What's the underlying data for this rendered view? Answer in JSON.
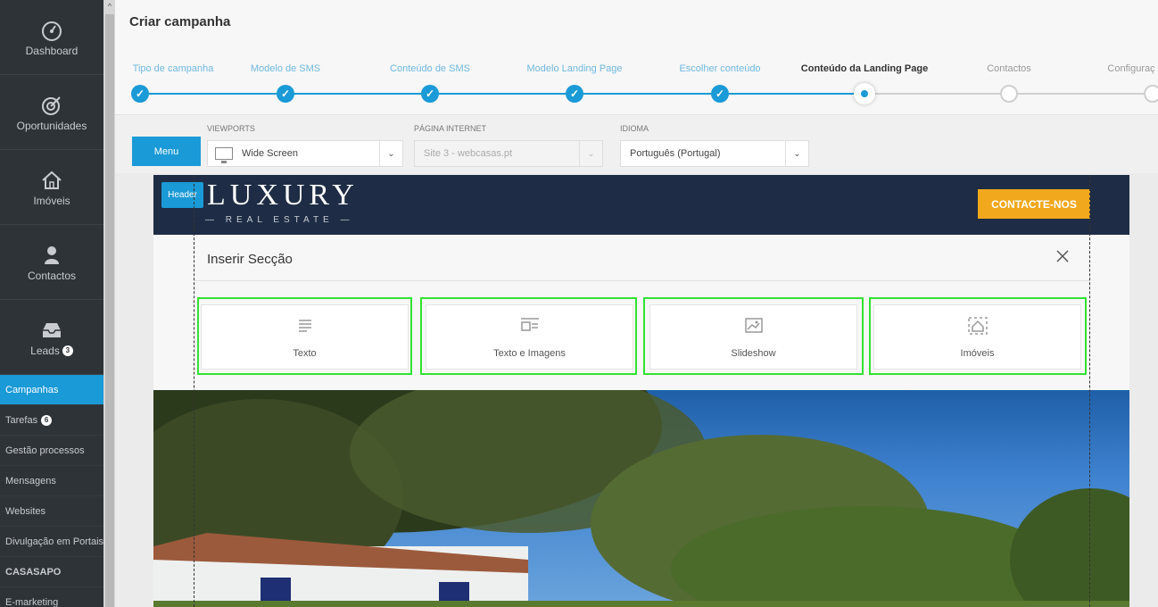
{
  "sidebar": {
    "big_items": [
      {
        "label": "Dashboard",
        "icon": "speedometer-icon"
      },
      {
        "label": "Oportunidades",
        "icon": "target-icon"
      },
      {
        "label": "Imóveis",
        "icon": "house-icon"
      },
      {
        "label": "Contactos",
        "icon": "person-icon"
      },
      {
        "label": "Leads",
        "icon": "inbox-icon",
        "badge": "3"
      }
    ],
    "small_items": [
      {
        "label": "Campanhas",
        "active": true
      },
      {
        "label": "Tarefas",
        "badge": "6"
      },
      {
        "label": "Gestão processos"
      },
      {
        "label": "Mensagens"
      },
      {
        "label": "Websites"
      },
      {
        "label": "Divulgação em Portais"
      },
      {
        "label": "CASASAPO"
      },
      {
        "label": "E-marketing"
      }
    ]
  },
  "header": {
    "title": "Criar campanha",
    "steps": [
      {
        "label": "Tipo de campanha",
        "state": "done"
      },
      {
        "label": "Modelo de SMS",
        "state": "done"
      },
      {
        "label": "Conteúdo de SMS",
        "state": "done"
      },
      {
        "label": "Modelo Landing Page",
        "state": "done"
      },
      {
        "label": "Escolher conteúdo",
        "state": "done"
      },
      {
        "label": "Conteúdo da Landing Page",
        "state": "current"
      },
      {
        "label": "Contactos",
        "state": "future"
      },
      {
        "label": "Configuraç",
        "state": "future"
      }
    ]
  },
  "toolbar": {
    "menu_label": "Menu",
    "viewports_label": "VIEWPORTS",
    "viewports_value": "Wide Screen",
    "page_label": "PÁGINA INTERNET",
    "page_value": "Site 3 - webcasas.pt",
    "language_label": "IDIOMA",
    "language_value": "Português (Portugal)"
  },
  "landing": {
    "header_badge": "Header",
    "logo_main": "LUXURY",
    "logo_sub": "— REAL ESTATE —",
    "contact_label": "CONTACTE-NOS"
  },
  "insert_section": {
    "title": "Inserir Secção",
    "options": [
      {
        "label": "Texto",
        "icon": "text-lines-icon"
      },
      {
        "label": "Texto e Imagens",
        "icon": "text-image-icon"
      },
      {
        "label": "Slideshow",
        "icon": "slideshow-icon"
      },
      {
        "label": "Imóveis",
        "icon": "property-icon"
      }
    ]
  },
  "colors": {
    "accent": "#1a9ad6",
    "sidebar_bg": "#2e3338",
    "header_bg": "#1e2d45",
    "cta": "#f2a81d",
    "highlight": "#33e233"
  }
}
